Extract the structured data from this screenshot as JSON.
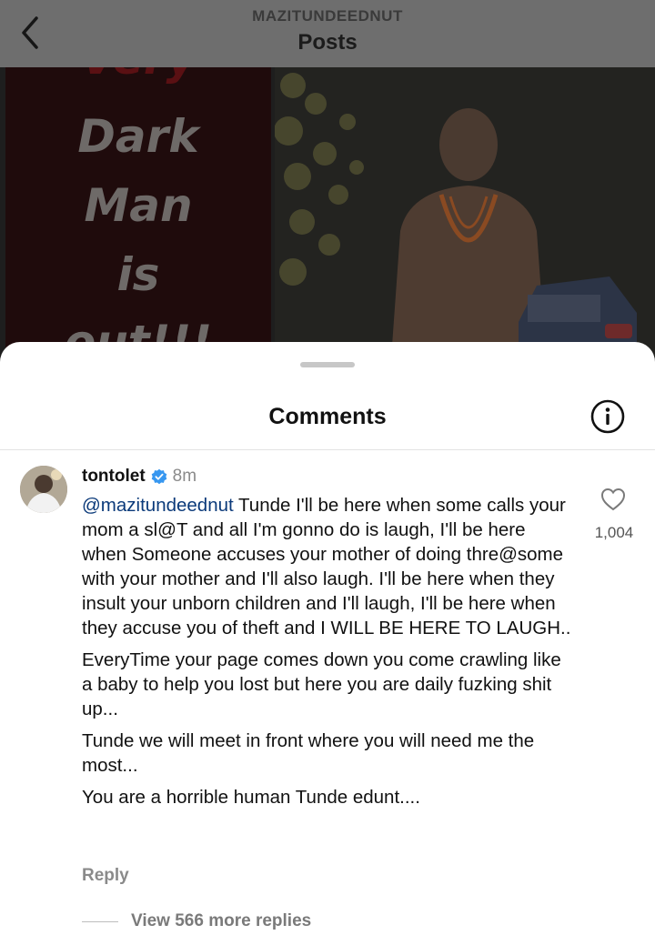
{
  "header": {
    "username": "MAZITUNDEEDNUT",
    "title": "Posts",
    "back_icon": "chevron-left-icon"
  },
  "post": {
    "overlay_text": [
      "Very",
      "Dark",
      "Man",
      "is",
      "out!!!"
    ]
  },
  "comments_sheet": {
    "title": "Comments",
    "info_icon": "info-icon"
  },
  "comment": {
    "username": "tontolet",
    "verified": true,
    "time": "8m",
    "mention": "@mazitundeednut",
    "paragraphs": [
      " Tunde I'll be here when some calls your mom a sl@T and all I'm gonno do is laugh, I'll be here when Someone accuses your mother of doing thre@some with your mother and I'll also laugh. I'll be here when they insult your unborn children and I'll laugh, I'll be here when they accuse you of theft and I WILL BE HERE TO LAUGH..",
      "EveryTime your page comes down you come crawling like a baby to help you lost but here you are daily fuzking shit up...",
      "Tunde we will meet in front where you will need me the most...",
      "You are a horrible human Tunde edunt...."
    ],
    "like_count": "1,004",
    "reply_label": "Reply",
    "view_replies_label": "View 566 more replies"
  },
  "colors": {
    "verified_blue": "#3797f0",
    "mention_blue": "#0b3a7a",
    "dim_overlay": "#6e6e6e"
  }
}
